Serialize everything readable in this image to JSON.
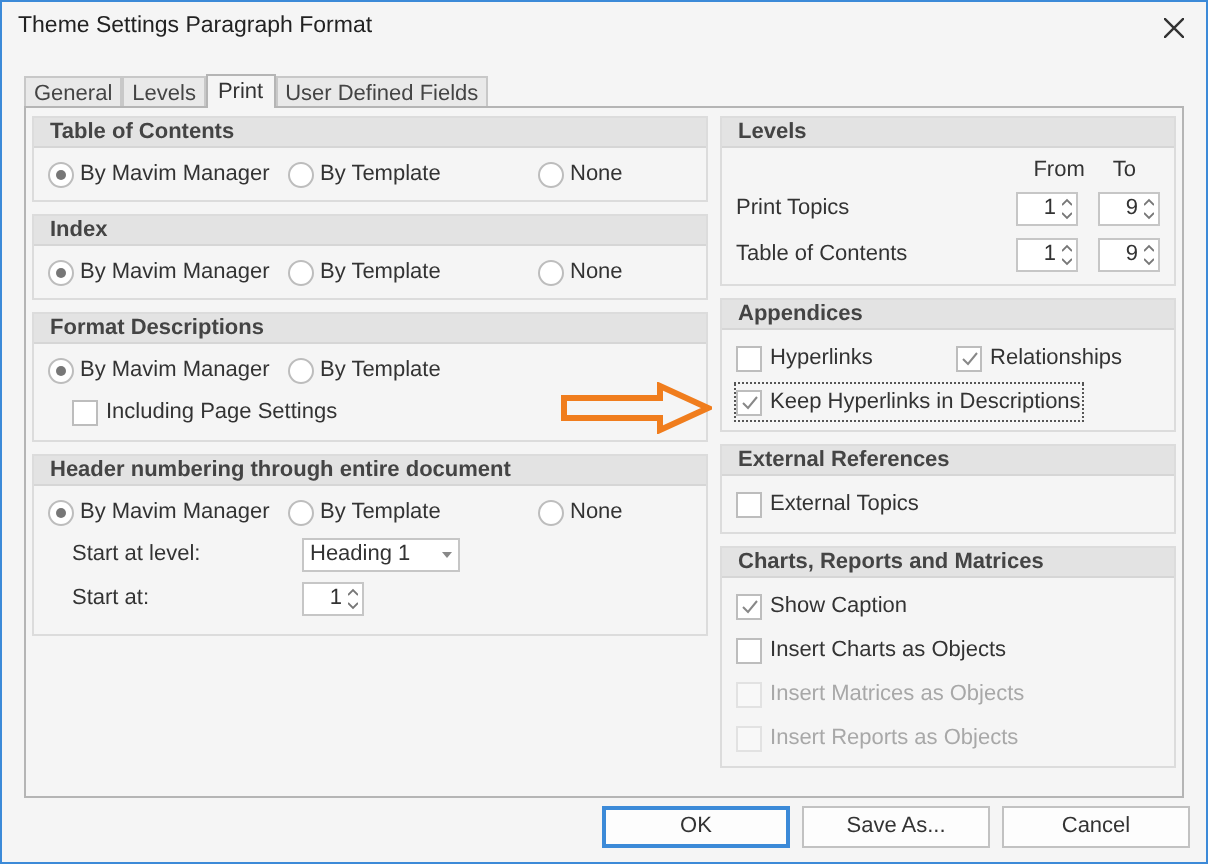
{
  "window": {
    "title": "Theme Settings Paragraph Format"
  },
  "tabs": [
    {
      "label": "General",
      "selected": false
    },
    {
      "label": "Levels",
      "selected": false
    },
    {
      "label": "Print",
      "selected": true
    },
    {
      "label": "User Defined Fields",
      "selected": false
    }
  ],
  "left_groups": [
    {
      "title": "Table of Contents",
      "rows": [
        {
          "kind": "radios",
          "options": [
            {
              "label": "By Mavim Manager",
              "selected": true
            },
            {
              "label": "By Template",
              "selected": false
            },
            {
              "label": "None",
              "selected": false
            }
          ]
        }
      ]
    },
    {
      "title": "Index",
      "rows": [
        {
          "kind": "radios",
          "options": [
            {
              "label": "By Mavim Manager",
              "selected": true
            },
            {
              "label": "By Template",
              "selected": false
            },
            {
              "label": "None",
              "selected": false
            }
          ]
        }
      ]
    },
    {
      "title": "Format Descriptions",
      "rows": [
        {
          "kind": "radios",
          "options": [
            {
              "label": "By Mavim Manager",
              "selected": true
            },
            {
              "label": "By Template",
              "selected": false
            }
          ]
        },
        {
          "kind": "indented_checkboxes",
          "items": [
            {
              "label": "Including Page Settings",
              "checked": false,
              "disabled": false,
              "focused": false
            }
          ]
        }
      ]
    },
    {
      "title": "Header numbering through entire document",
      "rows": [
        {
          "kind": "radios",
          "options": [
            {
              "label": "By Mavim Manager",
              "selected": true
            },
            {
              "label": "By Template",
              "selected": false
            },
            {
              "label": "None",
              "selected": false
            }
          ]
        },
        {
          "kind": "dropdown",
          "label": "Start at level:",
          "value": "Heading 1"
        },
        {
          "kind": "spinner",
          "label": "Start at:",
          "value": "1"
        }
      ]
    }
  ],
  "right_groups": [
    {
      "title": "Levels",
      "rows": [
        {
          "kind": "heads",
          "heads": [
            "From",
            "To"
          ]
        },
        {
          "kind": "range",
          "label": "Print Topics",
          "from": "1",
          "to": "9"
        },
        {
          "kind": "range",
          "label": "Table of Contents",
          "from": "1",
          "to": "9"
        }
      ]
    },
    {
      "title": "Appendices",
      "rows": [
        {
          "kind": "checkboxes",
          "items": [
            {
              "label": "Hyperlinks",
              "checked": false,
              "disabled": false,
              "focused": false
            },
            {
              "label": "Relationships",
              "checked": true,
              "disabled": false,
              "focused": false
            }
          ]
        },
        {
          "kind": "checkboxes",
          "items": [
            {
              "label": "Keep Hyperlinks in Descriptions",
              "checked": true,
              "disabled": false,
              "focused": true
            }
          ]
        }
      ]
    },
    {
      "title": "External References",
      "rows": [
        {
          "kind": "checkboxes",
          "items": [
            {
              "label": "External Topics",
              "checked": false,
              "disabled": false,
              "focused": false
            }
          ]
        }
      ]
    },
    {
      "title": "Charts, Reports and Matrices",
      "rows": [
        {
          "kind": "checkboxes",
          "items": [
            {
              "label": "Show Caption",
              "checked": true,
              "disabled": false,
              "focused": false
            }
          ]
        },
        {
          "kind": "checkboxes",
          "items": [
            {
              "label": "Insert Charts as Objects",
              "checked": false,
              "disabled": false,
              "focused": false
            }
          ]
        },
        {
          "kind": "checkboxes",
          "items": [
            {
              "label": "Insert Matrices as Objects",
              "checked": false,
              "disabled": true,
              "focused": false
            }
          ]
        },
        {
          "kind": "checkboxes",
          "items": [
            {
              "label": "Insert Reports as Objects",
              "checked": false,
              "disabled": true,
              "focused": false
            }
          ]
        }
      ]
    }
  ],
  "buttons": [
    {
      "label": "OK",
      "default": true
    },
    {
      "label": "Save As...",
      "default": false
    },
    {
      "label": "Cancel",
      "default": false
    }
  ]
}
